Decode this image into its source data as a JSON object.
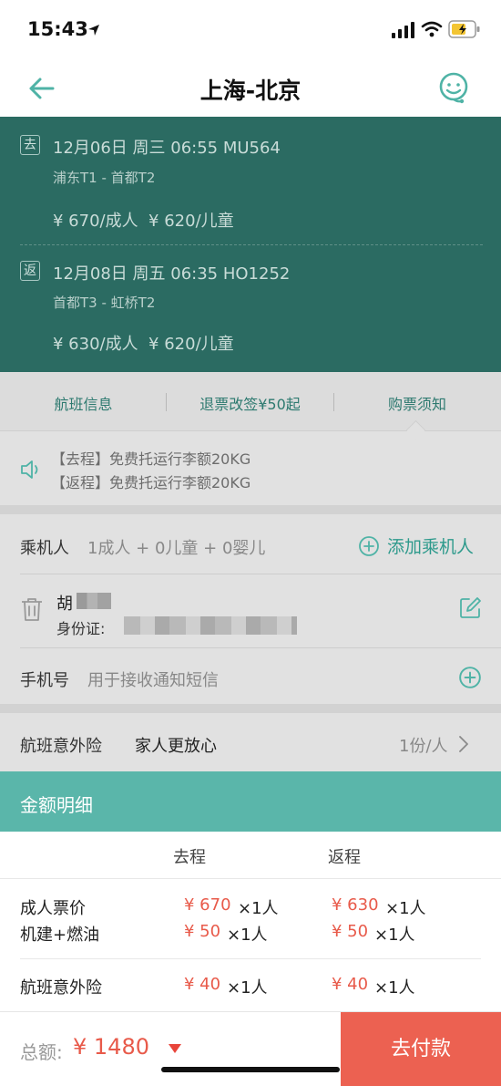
{
  "status_bar": {
    "time": "15:43"
  },
  "nav": {
    "title": "上海-北京"
  },
  "flights": {
    "outbound": {
      "tag": "去",
      "line1": "12月06日 周三 06:55 MU564",
      "route": "浦东T1 - 首都T2",
      "prices": "¥ 670/成人  ¥ 620/儿童"
    },
    "return": {
      "tag": "返",
      "line1": "12月08日 周五 06:35 HO1252",
      "route": "首都T3 - 虹桥T2",
      "prices": "¥ 630/成人  ¥ 620/儿童"
    }
  },
  "tabs": [
    {
      "label": "航班信息"
    },
    {
      "label": "退票改签¥50起"
    },
    {
      "label": "购票须知"
    }
  ],
  "notice": {
    "line1": "【去程】免费托运行李额20KG",
    "line2": "【返程】免费托运行李额20KG"
  },
  "passengers": {
    "label": "乘机人",
    "summary": "1成人 + 0儿童 + 0婴儿",
    "add_label": "添加乘机人",
    "entry_name": "胡",
    "entry_id_label": "身份证:"
  },
  "phone": {
    "label": "手机号",
    "placeholder": "用于接收通知短信"
  },
  "insurance": {
    "label": "航班意外险",
    "slogan": "家人更放心",
    "value": "1份/人"
  },
  "fare_detail": {
    "title": "金额明细",
    "col_outbound": "去程",
    "col_return": "返程",
    "rows": [
      {
        "label": "成人票价",
        "out_price": "¥ 670",
        "out_qty": "×1人",
        "ret_price": "¥ 630",
        "ret_qty": "×1人"
      },
      {
        "label": "机建+燃油",
        "out_price": "¥ 50",
        "out_qty": "×1人",
        "ret_price": "¥ 50",
        "ret_qty": "×1人"
      },
      {
        "label": "航班意外险",
        "out_price": "¥ 40",
        "out_qty": "×1人",
        "ret_price": "¥ 40",
        "ret_qty": "×1人"
      }
    ]
  },
  "footer": {
    "total_label": "总额:",
    "total_amount": "¥ 1480",
    "pay_label": "去付款"
  },
  "colors": {
    "teal_dark": "#2b6b62",
    "teal_accent": "#4fb3a6",
    "price_red": "#e85a4a",
    "pay_button": "#ec6151"
  },
  "icons": [
    "location-arrow-icon",
    "signal-icon",
    "wifi-icon",
    "battery-icon",
    "back-arrow-icon",
    "customer-service-icon",
    "speaker-icon",
    "add-circle-icon",
    "trash-icon",
    "edit-icon",
    "chevron-right-icon",
    "caret-down-icon"
  ]
}
